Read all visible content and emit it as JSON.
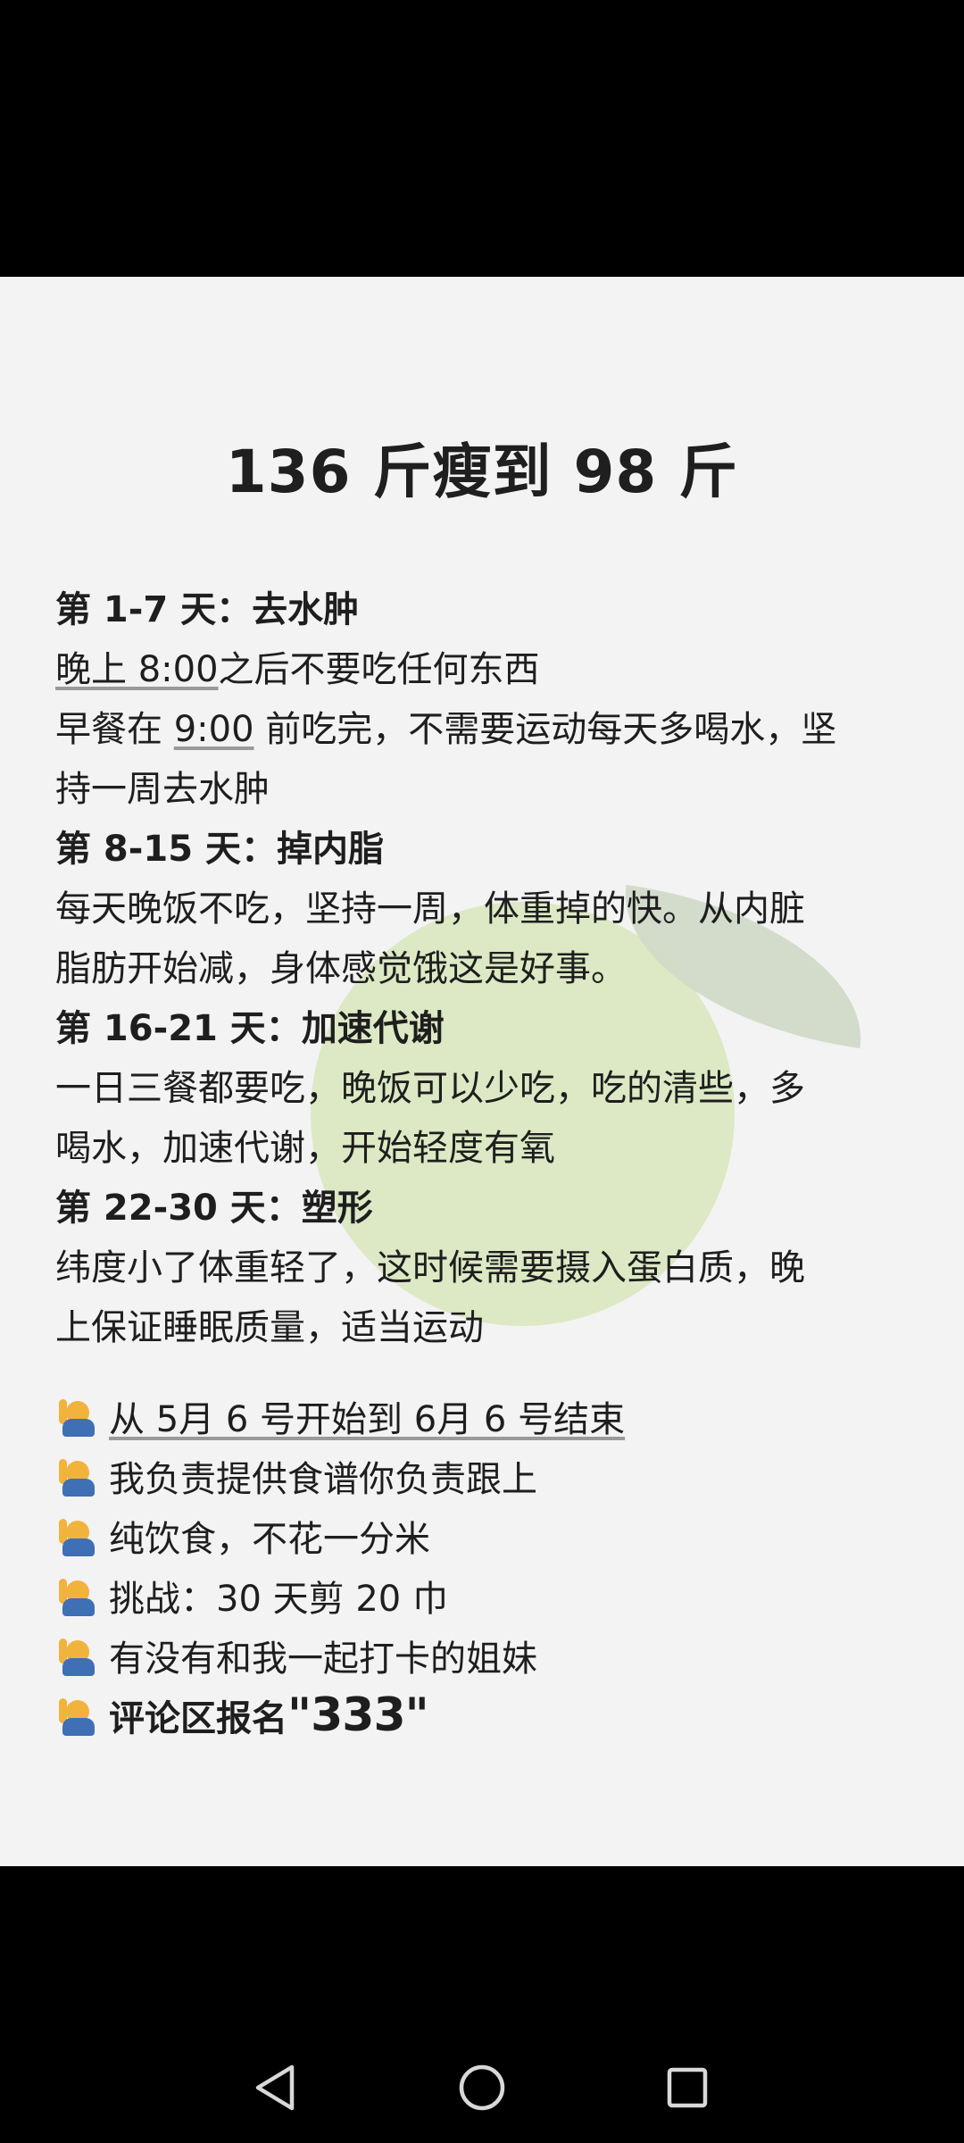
{
  "title": "136 斤瘦到 98 斤",
  "plan": {
    "stage1": {
      "heading": "第 1-7 天：去水肿",
      "line1_a": "晚上 8:00",
      "line1_b": "之后不要吃任何东西",
      "line2_a": "早餐在 ",
      "line2_b": "9:00",
      "line2_c": " 前吃完，不需要运动每天多喝水，坚",
      "line3": "持一周去水肿"
    },
    "stage2": {
      "heading": "第 8-15 天：掉内脂",
      "line1": "每天晚饭不吃，坚持一周，体重掉的快。从内脏",
      "line2": "脂肪开始减，身体感觉饿这是好事。"
    },
    "stage3": {
      "heading": "第 16-21 天：加速代谢",
      "line1": "一日三餐都要吃，晚饭可以少吃，吃的清些，多",
      "line2": "喝水，加速代谢，开始轻度有氧"
    },
    "stage4": {
      "heading": "第 22-30 天：塑形",
      "line1": "纬度小了体重轻了，这时候需要摄入蛋白质，晚",
      "line2": "上保证睡眠质量，适当运动"
    }
  },
  "list": {
    "item1": "从 5月 6 号开始到 6月 6 号结束",
    "item2": "我负责提供食谱你负责跟上",
    "item3": "纯饮食，不花一分米",
    "item4": "挑战：30 天剪 20 巾",
    "item5": "有没有和我一起打卡的姐妹",
    "item6_a": "评论区报名 ",
    "item6_b": "\"333\""
  },
  "icons": {
    "list_marker": "person-raising-hand-icon",
    "back": "back-triangle-icon",
    "home": "home-circle-icon",
    "recents": "recents-square-icon"
  },
  "colors": {
    "panel_bg": "#f3f3f3",
    "deco_circle": "#d7e6bb",
    "deco_leaf": "#cfd9c6",
    "text": "#1e1e1e"
  }
}
